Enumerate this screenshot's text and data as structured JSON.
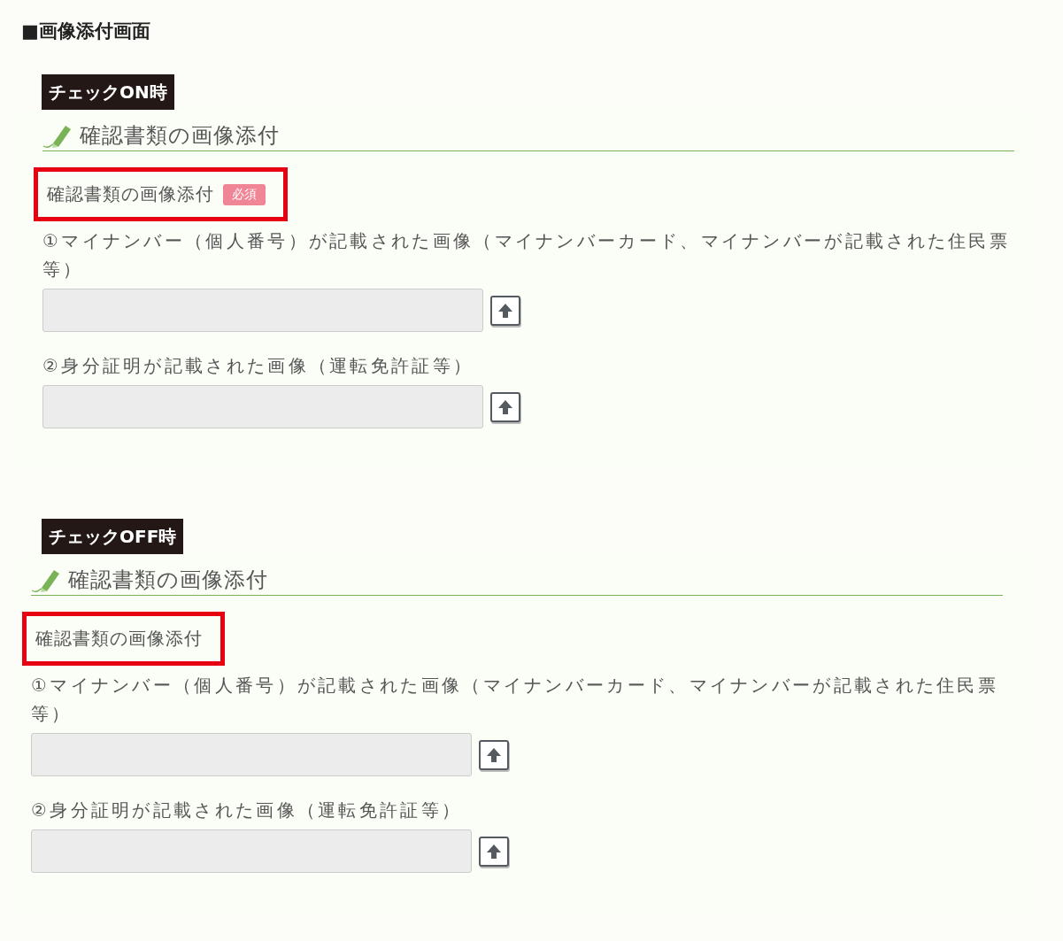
{
  "page_title": "■画像添付画面",
  "sections": [
    {
      "label": "チェックON時",
      "heading": "確認書類の画像添付",
      "field_label": "確認書類の画像添付",
      "required_badge": "必須",
      "highlighted": true,
      "uploads": [
        {
          "caption": "①マイナンバー（個人番号）が記載された画像（マイナンバーカード、マイナンバーが記載された住民票等）"
        },
        {
          "caption": "②身分証明が記載された画像（運転免許証等）"
        }
      ]
    },
    {
      "label": "チェックOFF時",
      "heading": "確認書類の画像添付",
      "field_label": "確認書類の画像添付",
      "highlighted": true,
      "uploads": [
        {
          "caption": "①マイナンバー（個人番号）が記載された画像（マイナンバーカード、マイナンバーが記載された住民票等）"
        },
        {
          "caption": "②身分証明が記載された画像（運転免許証等）"
        }
      ]
    }
  ]
}
